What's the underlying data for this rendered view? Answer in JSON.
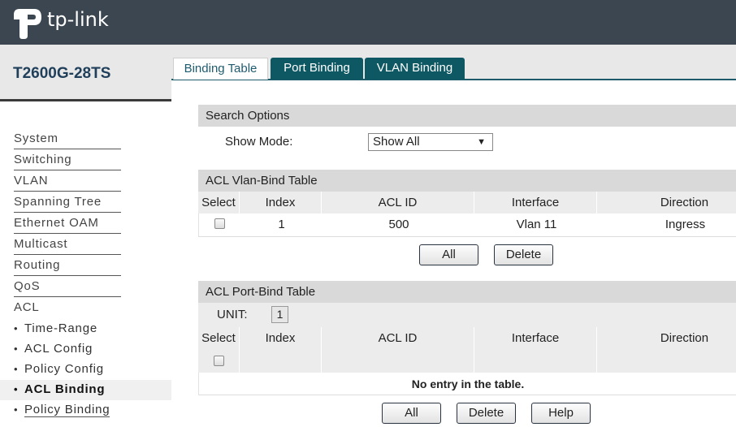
{
  "header": {
    "brand": "tp-link"
  },
  "device": {
    "model": "T2600G-28TS"
  },
  "menu": {
    "items": [
      "System",
      "Switching",
      "VLAN",
      "Spanning Tree",
      "Ethernet OAM",
      "Multicast",
      "Routing",
      "QoS",
      "ACL"
    ],
    "sub_items": [
      "Time-Range",
      "ACL Config",
      "Policy Config",
      "ACL Binding",
      "Policy Binding"
    ],
    "active_sub": "ACL Binding"
  },
  "tabs": [
    "Binding Table",
    "Port Binding",
    "VLAN Binding"
  ],
  "search": {
    "title": "Search Options",
    "show_mode_label": "Show Mode:",
    "show_mode_value": "Show All"
  },
  "vlan_table": {
    "title": "ACL Vlan-Bind Table",
    "columns": [
      "Select",
      "Index",
      "ACL ID",
      "Interface",
      "Direction"
    ],
    "rows": [
      {
        "index": "1",
        "acl_id": "500",
        "interface": "Vlan 11",
        "direction": "Ingress"
      }
    ],
    "buttons": [
      "All",
      "Delete"
    ]
  },
  "port_table": {
    "title": "ACL Port-Bind Table",
    "unit_label": "UNIT:",
    "unit_value": "1",
    "columns": [
      "Select",
      "Index",
      "ACL ID",
      "Interface",
      "Direction"
    ],
    "empty_text": "No entry in the table.",
    "buttons": [
      "All",
      "Delete",
      "Help"
    ]
  },
  "colors": {
    "header_bg": "#3c4650",
    "tab_active_text": "#1e5b6e",
    "tab_inactive_bg": "#0e5864",
    "model_text": "#1f3f5a"
  }
}
